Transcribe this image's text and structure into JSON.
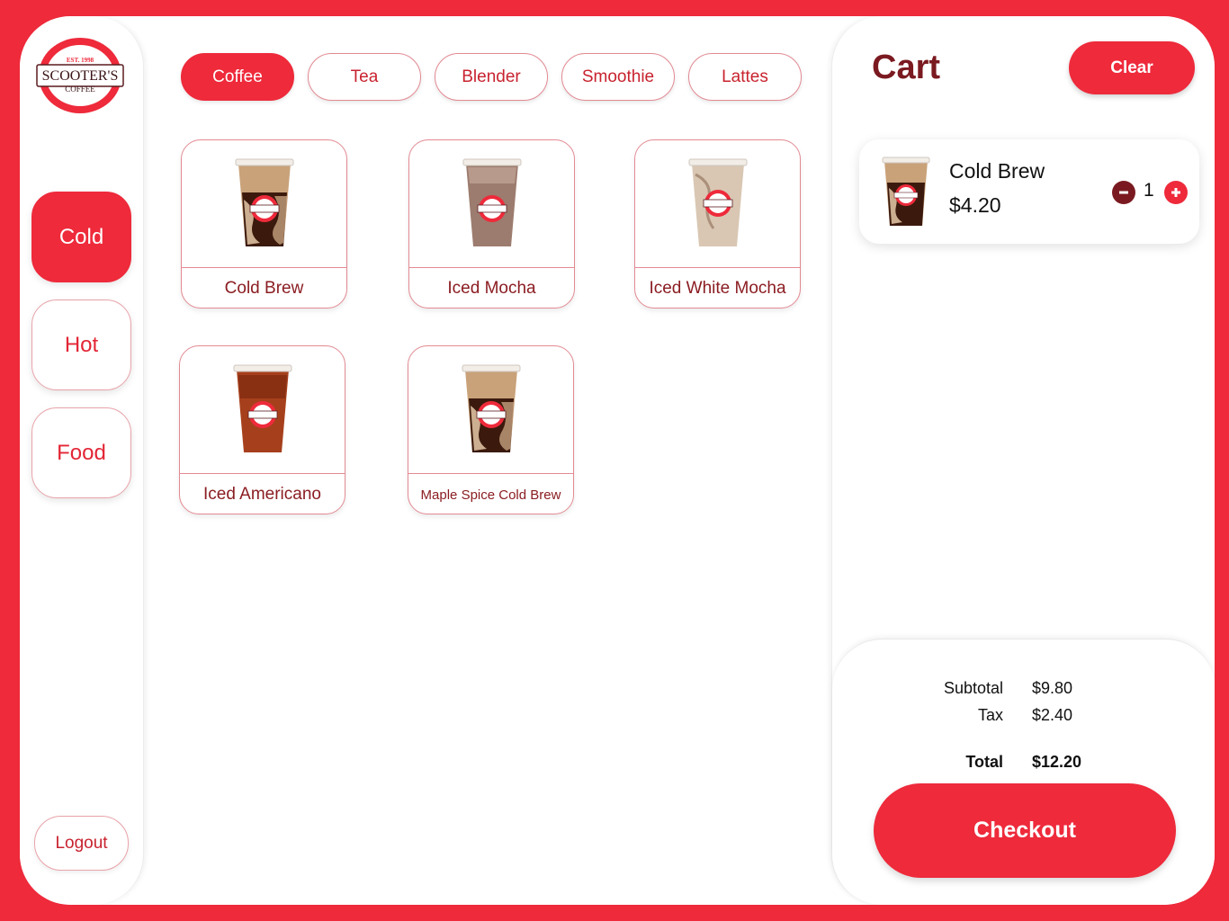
{
  "brand": {
    "est": "EST. 1998",
    "name": "SCOOTER'S",
    "sub": "COFFEE",
    "accent": "#ee2a3b",
    "dark": "#7a1a20"
  },
  "sidebar": {
    "items": [
      {
        "label": "Cold",
        "active": true
      },
      {
        "label": "Hot",
        "active": false
      },
      {
        "label": "Food",
        "active": false
      }
    ],
    "logout_label": "Logout"
  },
  "tabs": [
    {
      "label": "Coffee",
      "active": true
    },
    {
      "label": "Tea",
      "active": false
    },
    {
      "label": "Blender",
      "active": false
    },
    {
      "label": "Smoothie",
      "active": false
    },
    {
      "label": "Lattes",
      "active": false
    }
  ],
  "products": [
    {
      "name": "Cold Brew",
      "drink": "cold-brew"
    },
    {
      "name": "Iced Mocha",
      "drink": "mocha"
    },
    {
      "name": "Iced White Mocha",
      "drink": "white-mocha"
    },
    {
      "name": "Iced Americano",
      "drink": "americano"
    },
    {
      "name": "Maple Spice Cold Brew",
      "drink": "cold-brew"
    }
  ],
  "cart": {
    "title": "Cart",
    "clear_label": "Clear",
    "items": [
      {
        "name": "Cold Brew",
        "price": "$4.20",
        "qty": "1"
      }
    ],
    "summary": {
      "subtotal_label": "Subtotal",
      "subtotal": "$9.80",
      "tax_label": "Tax",
      "tax": "$2.40",
      "total_label": "Total",
      "total": "$12.20"
    },
    "checkout_label": "Checkout"
  }
}
